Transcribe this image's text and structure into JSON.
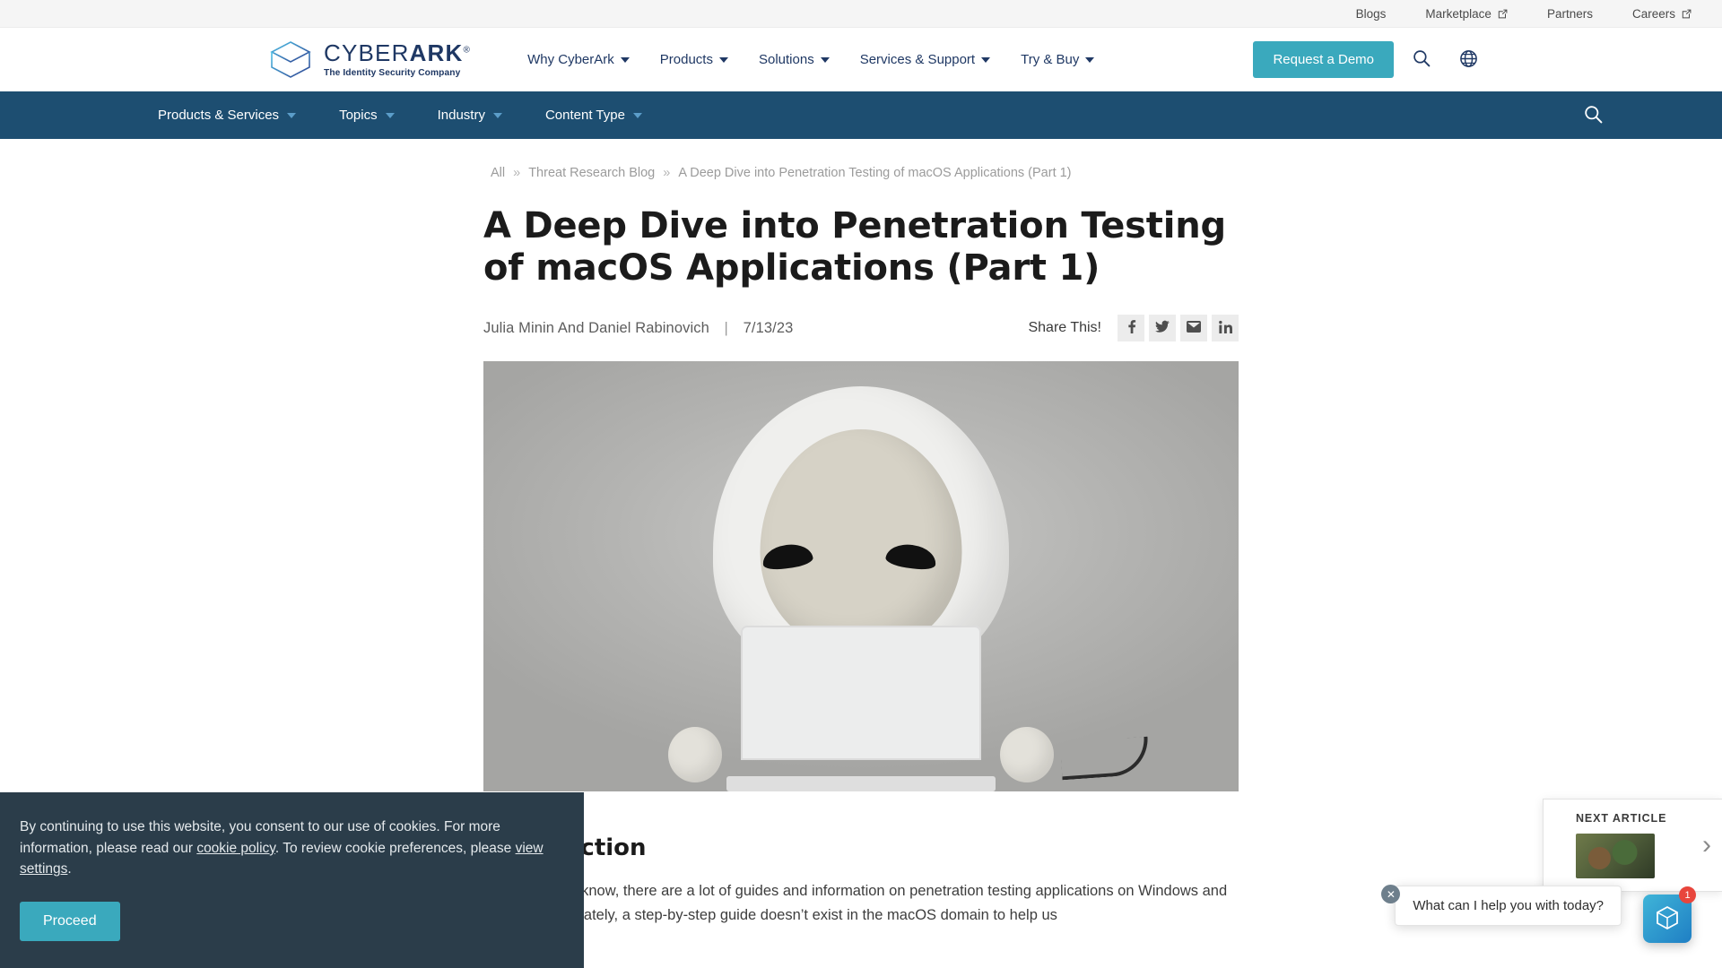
{
  "utility_bar": {
    "links": [
      {
        "label": "Blogs",
        "external": false
      },
      {
        "label": "Marketplace",
        "external": true
      },
      {
        "label": "Partners",
        "external": false
      },
      {
        "label": "Careers",
        "external": true
      }
    ]
  },
  "header": {
    "logo": {
      "word_light": "CYBER",
      "word_bold": "ARK",
      "registered": "®",
      "tagline": "The Identity Security Company"
    },
    "nav": [
      {
        "label": "Why CyberArk",
        "has_dropdown": true
      },
      {
        "label": "Products",
        "has_dropdown": true
      },
      {
        "label": "Solutions",
        "has_dropdown": true
      },
      {
        "label": "Services & Support",
        "has_dropdown": true
      },
      {
        "label": "Try & Buy",
        "has_dropdown": true
      }
    ],
    "demo_button": "Request a Demo",
    "search_icon": "search-icon",
    "globe_icon": "globe-icon",
    "accent_color": "#3aa9bd"
  },
  "subnav": {
    "background": "#1d4e71",
    "items": [
      {
        "label": "Products & Services",
        "has_dropdown": true
      },
      {
        "label": "Topics",
        "has_dropdown": true
      },
      {
        "label": "Industry",
        "has_dropdown": true
      },
      {
        "label": "Content Type",
        "has_dropdown": true
      }
    ],
    "search_icon": "search-icon"
  },
  "breadcrumb": {
    "items": [
      "All",
      "Threat Research Blog",
      "A Deep Dive into Penetration Testing of macOS Applications (Part 1)"
    ],
    "separator": "»"
  },
  "article": {
    "title": "A Deep Dive into Penetration Testing of macOS Applications (Part 1)",
    "authors": "Julia Minin And Daniel Rabinovich",
    "meta_divider": "|",
    "date": "7/13/23",
    "share_label": "Share This!",
    "share_buttons": [
      {
        "name": "facebook-share-button",
        "glyph": "f"
      },
      {
        "name": "twitter-share-button",
        "glyph": "t"
      },
      {
        "name": "email-share-button",
        "glyph": "e"
      },
      {
        "name": "linkedin-share-button",
        "glyph": "in"
      }
    ],
    "hero_image_alt": "Hooded figure mascot using a laptop",
    "section_heading": "Introduction",
    "body_paragraph": "As many of us know, there are a lot of guides and information on penetration testing applications on Windows and Linux. Unfortunately, a step-by-step guide doesn’t exist in the macOS domain to help us"
  },
  "cookie_banner": {
    "text_before_policy": "By continuing to use this website, you consent to our use of cookies. For more information, please read our ",
    "policy_link": "cookie policy",
    "text_middle": ". To review cookie preferences, please ",
    "settings_link": "view settings",
    "text_after": ".",
    "button": "Proceed",
    "background": "#2b3d4a"
  },
  "next_article": {
    "label": "NEXT ARTICLE",
    "arrow": "›"
  },
  "chat": {
    "message": "What can I help you with today?",
    "close_glyph": "✕",
    "badge_count": "1",
    "launcher_icon": "chat-launcher-icon"
  }
}
